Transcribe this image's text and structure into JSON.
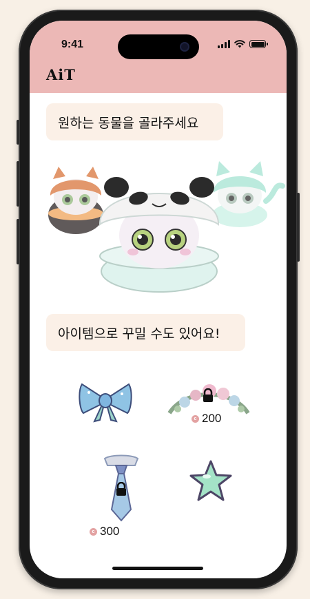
{
  "status_bar": {
    "time": "9:41",
    "signal_icon": "cellular-signal-icon",
    "wifi_icon": "wifi-icon",
    "battery_icon": "battery-icon"
  },
  "header": {
    "logo": "AiT",
    "background_color": "#ecb8b6"
  },
  "prompts": {
    "choose_animal": "원하는 동물을 골라주세요",
    "decorate_items": "아이템으로 꾸밀 수도 있어요!"
  },
  "animals": [
    {
      "name": "raccoon",
      "icon": "raccoon-egg-icon",
      "selected": false
    },
    {
      "name": "panda",
      "icon": "panda-egg-icon",
      "selected": true
    },
    {
      "name": "cat",
      "icon": "cat-egg-icon",
      "selected": false
    }
  ],
  "items": [
    {
      "name": "bow",
      "icon": "bow-icon",
      "locked": false,
      "price": ""
    },
    {
      "name": "flower-crown",
      "icon": "flower-crown-icon",
      "locked": true,
      "price": "200"
    },
    {
      "name": "tie",
      "icon": "tie-icon",
      "locked": true,
      "price": "300"
    },
    {
      "name": "star",
      "icon": "star-icon",
      "locked": false,
      "price": ""
    }
  ],
  "currency_icon": "coin-icon",
  "coin_letter": "c"
}
